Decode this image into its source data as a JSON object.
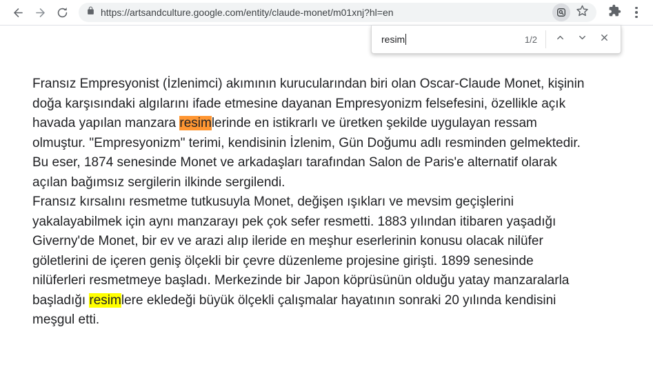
{
  "browser": {
    "url": "https://artsandculture.google.com/entity/claude-monet/m01xnj?hl=en",
    "icons": {
      "back": "back-arrow-icon",
      "forward": "forward-arrow-icon",
      "reload": "reload-icon",
      "lock": "lock-icon",
      "page_search": "document-search-icon",
      "bookmark": "star-icon",
      "extensions": "puzzle-icon",
      "menu": "kebab-menu-icon"
    }
  },
  "find_bar": {
    "query": "resim",
    "match_count": "1/2",
    "icons": {
      "previous": "chevron-up-icon",
      "next": "chevron-down-icon",
      "close": "close-icon"
    }
  },
  "colors": {
    "active_highlight": "#ff9632",
    "inactive_highlight": "#ffff00",
    "toolbar_icon": "#5f6368",
    "omnibox_bg": "#f1f3f4",
    "text": "#202124"
  },
  "article": {
    "lines": [
      [
        {
          "t": "Fransız Empresyonist (İzlenimci) akımının kurucularından biri olan Oscar-Claude Monet, kişinin"
        }
      ],
      [
        {
          "t": "doğa karşısındaki algılarını ifade etmesine dayanan Empresyonizm felsefesini, özellikle açık"
        }
      ],
      [
        {
          "t": "havada yapılan manzara "
        },
        {
          "t": "resim",
          "h": "active"
        },
        {
          "t": "lerinde en istikrarlı ve üretken şekilde uygulayan ressam"
        }
      ],
      [
        {
          "t": "olmuştur. \"Empresyonizm\" terimi, kendisinin İzlenim, Gün Doğumu adlı resminden gelmektedir."
        }
      ],
      [
        {
          "t": "Bu eser, 1874 senesinde Monet ve arkadaşları tarafından Salon de Paris'e alternatif olarak"
        }
      ],
      [
        {
          "t": "açılan bağımsız sergilerin ilkinde sergilendi."
        }
      ],
      [
        {
          "t": "Fransız kırsalını resmetme tutkusuyla Monet, değişen ışıkları ve mevsim geçişlerini"
        }
      ],
      [
        {
          "t": "yakalayabilmek için aynı manzarayı pek çok sefer resmetti. 1883 yılından itibaren yaşadığı"
        }
      ],
      [
        {
          "t": "Giverny'de Monet, bir ev ve arazi alıp ileride en meşhur eserlerinin konusu olacak nilüfer"
        }
      ],
      [
        {
          "t": "göletlerini de içeren geniş ölçekli bir çevre düzenleme projesine girişti. 1899 senesinde"
        }
      ],
      [
        {
          "t": "nilüferleri resmetmeye başladı. Merkezinde bir Japon köprüsünün olduğu yatay manzaralarla"
        }
      ],
      [
        {
          "t": "başladığı "
        },
        {
          "t": "resim",
          "h": "match"
        },
        {
          "t": "lere ekledeği büyük ölçekli çalışmalar hayatının sonraki 20 yılında kendisini"
        }
      ],
      [
        {
          "t": "meşgul etti."
        }
      ]
    ]
  }
}
